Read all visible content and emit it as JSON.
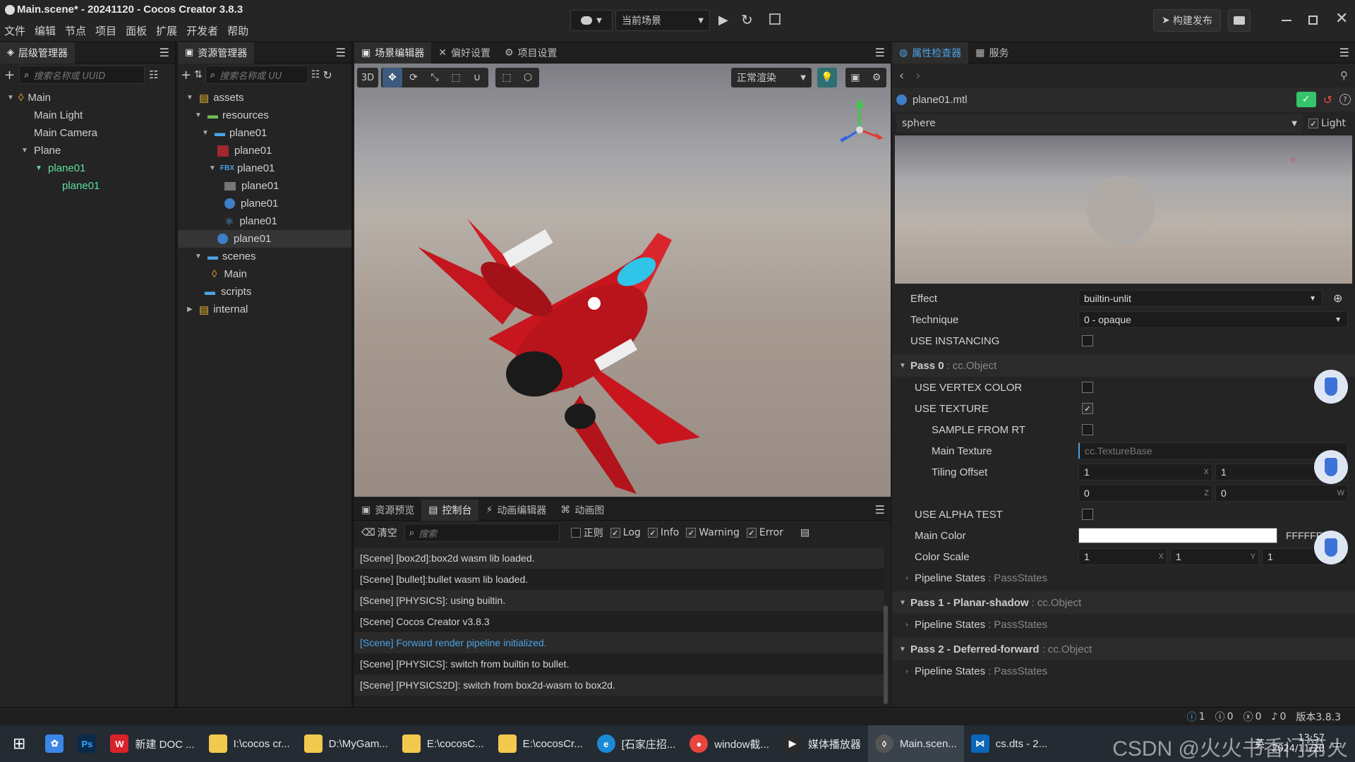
{
  "window": {
    "title": "Main.scene* - 20241120 - Cocos Creator 3.8.3"
  },
  "menu": [
    "文件",
    "编辑",
    "节点",
    "项目",
    "面板",
    "扩展",
    "开发者",
    "帮助"
  ],
  "toolbar": {
    "scene_select": "当前场景",
    "build_label": "构建发布"
  },
  "hierarchy": {
    "tab": "层级管理器",
    "search_placeholder": "搜索名称或 UUID",
    "items": [
      {
        "label": "Main"
      },
      {
        "label": "Main Light"
      },
      {
        "label": "Main Camera"
      },
      {
        "label": "Plane"
      },
      {
        "label": "plane01"
      },
      {
        "label": "plane01"
      }
    ]
  },
  "assets": {
    "tab": "资源管理器",
    "search_placeholder": "搜索名称或 UU",
    "items": [
      {
        "label": "assets"
      },
      {
        "label": "resources"
      },
      {
        "label": "plane01"
      },
      {
        "label": "plane01"
      },
      {
        "label": "plane01",
        "prefix": "FBX"
      },
      {
        "label": "plane01"
      },
      {
        "label": "plane01"
      },
      {
        "label": "plane01"
      },
      {
        "label": "plane01"
      },
      {
        "label": "scenes"
      },
      {
        "label": "Main"
      },
      {
        "label": "scripts"
      },
      {
        "label": "internal"
      }
    ]
  },
  "center_tabs": [
    "场景编辑器",
    "偏好设置",
    "项目设置"
  ],
  "scene_toolbar": {
    "mode": "3D",
    "render_mode": "正常渲染"
  },
  "bottom_tabs": [
    "资源预览",
    "控制台",
    "动画编辑器",
    "动画图"
  ],
  "console": {
    "clear_label": "清空",
    "search_placeholder": "搜索",
    "filters": [
      {
        "label": "正则",
        "checked": false
      },
      {
        "label": "Log",
        "checked": true
      },
      {
        "label": "Info",
        "checked": true
      },
      {
        "label": "Warning",
        "checked": true
      },
      {
        "label": "Error",
        "checked": true
      }
    ],
    "logs": [
      {
        "text": "[Scene] [box2d]:box2d wasm lib loaded."
      },
      {
        "text": "[Scene] [bullet]:bullet wasm lib loaded."
      },
      {
        "text": "[Scene] [PHYSICS]: using builtin."
      },
      {
        "text": "[Scene] Cocos Creator v3.8.3"
      },
      {
        "text": "[Scene] Forward render pipeline initialized."
      },
      {
        "text": "[Scene] [PHYSICS]: switch from builtin to bullet."
      },
      {
        "text": "[Scene] [PHYSICS2D]: switch from box2d-wasm to box2d."
      }
    ]
  },
  "inspector": {
    "tabs": [
      "属性检查器",
      "服务"
    ],
    "asset_name": "plane01.mtl",
    "preview_shape": "sphere",
    "light_label": "Light",
    "effect_label": "Effect",
    "effect_value": "builtin-unlit",
    "technique_label": "Technique",
    "technique_value": "0 - opaque",
    "instancing_label": "USE INSTANCING",
    "pass0": {
      "title": "Pass 0",
      "type": "cc.Object"
    },
    "use_vertex_color": "USE VERTEX COLOR",
    "use_texture": "USE TEXTURE",
    "sample_from_rt": "SAMPLE FROM RT",
    "main_texture_label": "Main Texture",
    "main_texture_value": "cc.TextureBase",
    "tiling_label": "Tiling Offset",
    "tiling": {
      "x": "1",
      "y": "1",
      "z": "0",
      "w": "0"
    },
    "tiling_axes": {
      "x": "X",
      "y": "Y",
      "z": "Z",
      "w": "W"
    },
    "alpha_test": "USE ALPHA TEST",
    "main_color_label": "Main Color",
    "main_color_hex": "FFFFFF",
    "color_scale_label": "Color Scale",
    "color_scale": {
      "x": "1",
      "y": "1",
      "z": "1"
    },
    "color_scale_axes": {
      "x": "X",
      "y": "Y",
      "z": "Z"
    },
    "pipeline_states": "Pipeline States",
    "pass_states": "PassStates",
    "pass1": {
      "title": "Pass 1 - Planar-shadow",
      "type": "cc.Object"
    },
    "pass2": {
      "title": "Pass 2 - Deferred-forward",
      "type": "cc.Object"
    }
  },
  "statusbar": {
    "info": "1",
    "warn": "0",
    "error": "0",
    "notice": "0",
    "version": "版本3.8.3"
  },
  "taskbar": {
    "items": [
      {
        "label": "新建 DOC ..."
      },
      {
        "label": "I:\\cocos cr..."
      },
      {
        "label": "D:\\MyGam..."
      },
      {
        "label": "E:\\cocosC..."
      },
      {
        "label": "E:\\cocosCr..."
      },
      {
        "label": "[石家庄招..."
      },
      {
        "label": "window截..."
      },
      {
        "label": "媒体播放器"
      },
      {
        "label": "Main.scen..."
      },
      {
        "label": "cs.dts - 2..."
      }
    ],
    "clock_time": "13:57",
    "clock_date": "2024/11/20",
    "ime": "英",
    "watermark": "CSDN @火火书香门第火"
  },
  "colors": {
    "accent": "#4aa3e6",
    "selection_green": "#5fdf9a",
    "check_green": "#35c46a"
  }
}
